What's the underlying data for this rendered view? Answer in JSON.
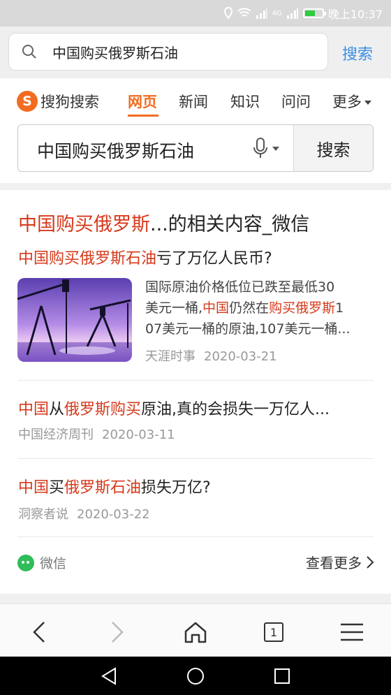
{
  "status_bar": {
    "time": "晚上10:37",
    "network": "4G"
  },
  "browser": {
    "query": "中国购买俄罗斯石油",
    "search_button": "搜索"
  },
  "sogou": {
    "logo_text": "搜狗搜索",
    "logo_mark": "S",
    "tabs": [
      {
        "label": "网页",
        "active": true
      },
      {
        "label": "新闻",
        "active": false
      },
      {
        "label": "知识",
        "active": false
      },
      {
        "label": "问问",
        "active": false
      },
      {
        "label": "更多",
        "active": false
      }
    ],
    "query": "中国购买俄罗斯石油",
    "search_button": "搜索"
  },
  "card": {
    "title_hl": "中国购买俄罗斯",
    "title_rest": "...的相关内容_微信",
    "results": [
      {
        "title_hl": "中国购买俄罗斯石油",
        "title_rest": "亏了万亿人民币?",
        "snippet": {
          "l1": "国际原油价格低位已跌至最低30",
          "l2_a": "美元一桶,",
          "l2_hl1": "中国",
          "l2_b": "仍然在",
          "l2_hl2": "购买俄罗斯",
          "l2_c": "1",
          "l3": "07美元一桶的原油,107美元一桶..."
        },
        "source": "天涯时事",
        "date": "2020-03-21"
      },
      {
        "title_hl1": "中国",
        "title_a": "从",
        "title_hl2": "俄罗斯购买",
        "title_rest": "原油,真的会损失一万亿人...",
        "source": "中国经济周刊",
        "date": "2020-03-11"
      },
      {
        "title_hl1": "中国",
        "title_a": "买",
        "title_hl2": "俄罗斯石油",
        "title_rest": "损失万亿?",
        "source": "洞察者说",
        "date": "2020-03-22"
      }
    ],
    "footer_source": "微信",
    "see_more": "查看更多"
  },
  "toolbar": {
    "tab_count": "1"
  },
  "colors": {
    "accent": "#f26c21",
    "highlight": "#d6391b",
    "link_blue": "#3a8ee6"
  }
}
